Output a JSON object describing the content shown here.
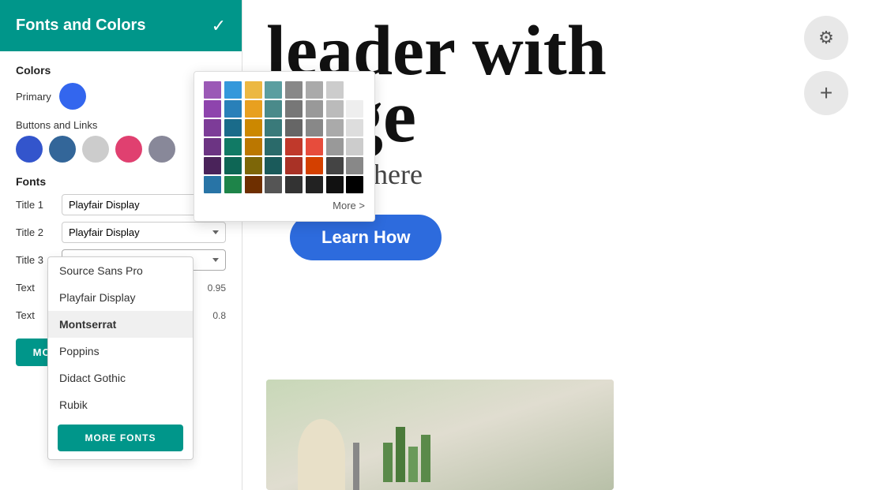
{
  "header": {
    "title": "Fonts and Colors",
    "check_icon": "✓"
  },
  "colors_section": {
    "label": "Colors",
    "primary_label": "Primary",
    "buttons_links_label": "Buttons and  Links",
    "swatches": [
      {
        "color": "#3355cc",
        "name": "swatch-dark-blue"
      },
      {
        "color": "#336699",
        "name": "swatch-medium-blue"
      },
      {
        "color": "#cccccc",
        "name": "swatch-light-gray"
      },
      {
        "color": "#e04070",
        "name": "swatch-pink"
      },
      {
        "color": "#888899",
        "name": "swatch-gray-blue"
      }
    ],
    "primary_color": "#3366ee"
  },
  "fonts_section": {
    "label": "Fonts",
    "rows": [
      {
        "label": "Title 1",
        "value": "Playfair Display",
        "scale": null
      },
      {
        "label": "Title 2",
        "value": "Playfair Display",
        "scale": null
      },
      {
        "label": "Title 3",
        "value": "Montserrat",
        "scale": null
      },
      {
        "label": "Text",
        "value": "Source Sans Pro",
        "scale": "0.95"
      },
      {
        "label": "Text",
        "value": "Playfair Display",
        "scale": "0.8"
      }
    ],
    "more_fonts_btn": "MORE FONTS"
  },
  "color_picker": {
    "colors": [
      "#9b59b6",
      "#3498db",
      "#ecb842",
      "#5b9ea0",
      "#888",
      "#aaa",
      "#ccc",
      "#fff",
      "#8e44ad",
      "#2980b9",
      "#e8a020",
      "#4a8a8a",
      "#777",
      "#999",
      "#bbb",
      "#eee",
      "#7d3c98",
      "#1a6b8a",
      "#cc8800",
      "#3a7a7a",
      "#666",
      "#888",
      "#aaa",
      "#ddd",
      "#6c3483",
      "#117a65",
      "#bb7700",
      "#2a6a6a",
      "#c0392b",
      "#e74c3c",
      "#999",
      "#ccc",
      "#4a235a",
      "#0e6655",
      "#7d6608",
      "#1a5a5a",
      "#a93226",
      "#d44000",
      "#444",
      "#888",
      "#2874a6",
      "#1e8449",
      "#6e2f00",
      "#555555",
      "#333333",
      "#222222",
      "#111111",
      "#000000"
    ],
    "more_label": "More >"
  },
  "font_dropdown": {
    "options": [
      {
        "label": "Source Sans Pro",
        "selected": false
      },
      {
        "label": "Playfair Display",
        "selected": false
      },
      {
        "label": "Montserrat",
        "selected": true
      },
      {
        "label": "Poppins",
        "selected": false
      },
      {
        "label": "Didact Gothic",
        "selected": false
      },
      {
        "label": "Rubik",
        "selected": false
      }
    ],
    "more_btn_label": "MORE FONTS"
  },
  "main_content": {
    "hero_title": "leader with",
    "hero_title_prefix": "",
    "hero_subtitle": "age",
    "hero_subtitle_prefix": "n",
    "body_text": "r subtitle here",
    "learn_how": "Learn How"
  },
  "fab": {
    "gear_icon": "⚙",
    "plus_icon": "+"
  }
}
